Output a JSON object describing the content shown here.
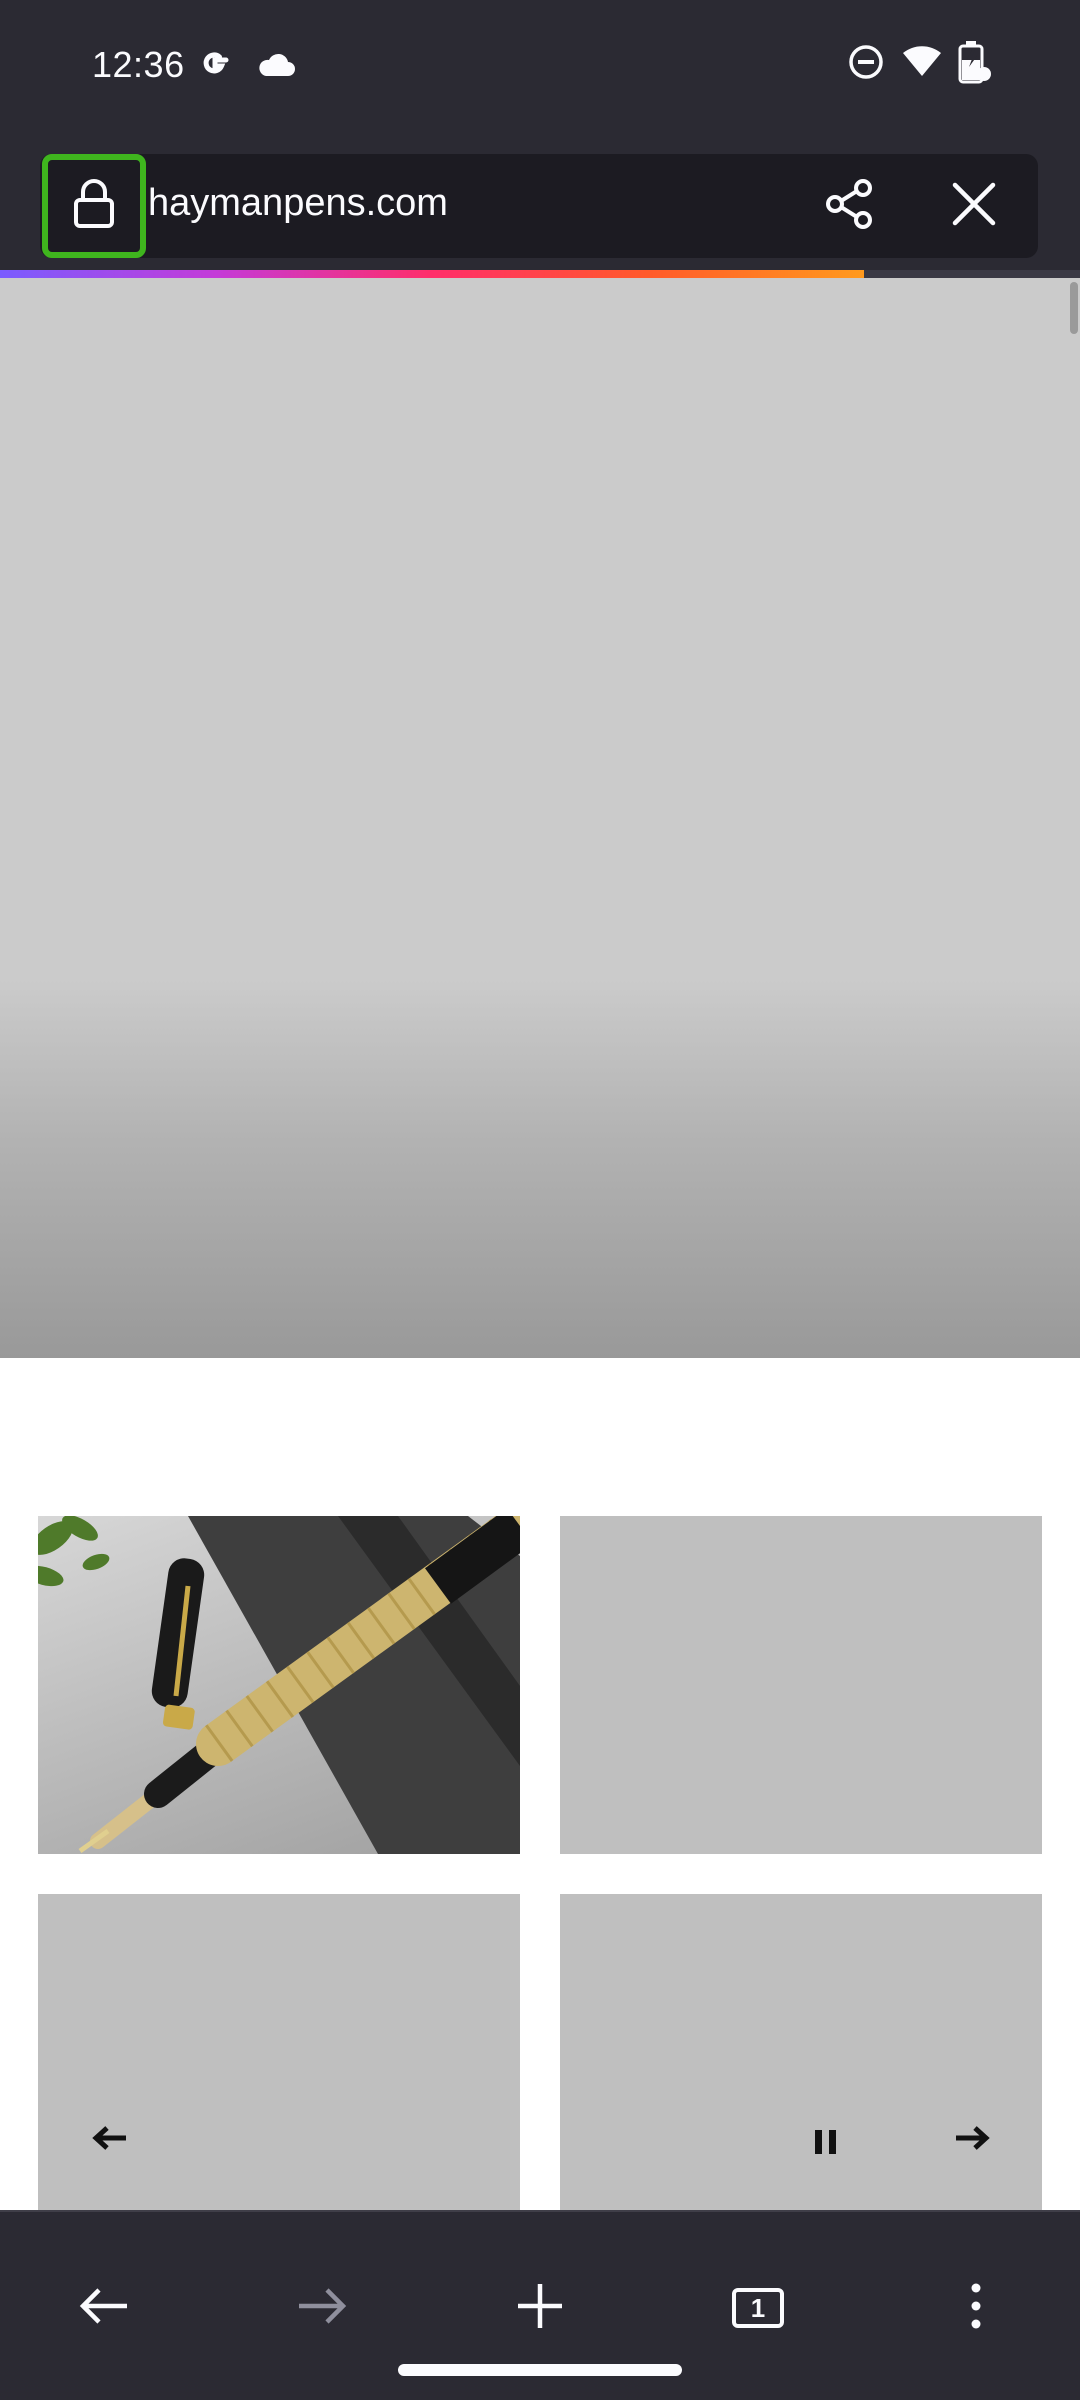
{
  "status_bar": {
    "time": "12:36",
    "icons": [
      "google-icon",
      "cloud-icon",
      "do-not-disturb-icon",
      "wifi-icon",
      "battery-icon"
    ]
  },
  "toolbar": {
    "url": "haymanpens.com",
    "lock_icon": "lock-icon",
    "share_icon": "share-icon",
    "close_icon": "close-icon",
    "highlight_color": "#3fb51e"
  },
  "page_load_progress": 0.8,
  "page": {
    "hero": "blank-gray-banner",
    "tiles": [
      "pen-photo",
      "gray-placeholder",
      "gray-placeholder",
      "gray-placeholder"
    ],
    "slider_controls": [
      "prev-arrow-icon",
      "pause-icon",
      "next-arrow-icon"
    ]
  },
  "bottom_bar": {
    "items": [
      "back",
      "forward",
      "new-tab",
      "tabs",
      "menu"
    ],
    "tab_count": "1"
  },
  "colors": {
    "chrome_bg": "#2b2a33",
    "url_field_bg": "#1c1b22",
    "foreground": "#fbfbfe",
    "placeholder_gray": "#bfbfbf"
  }
}
